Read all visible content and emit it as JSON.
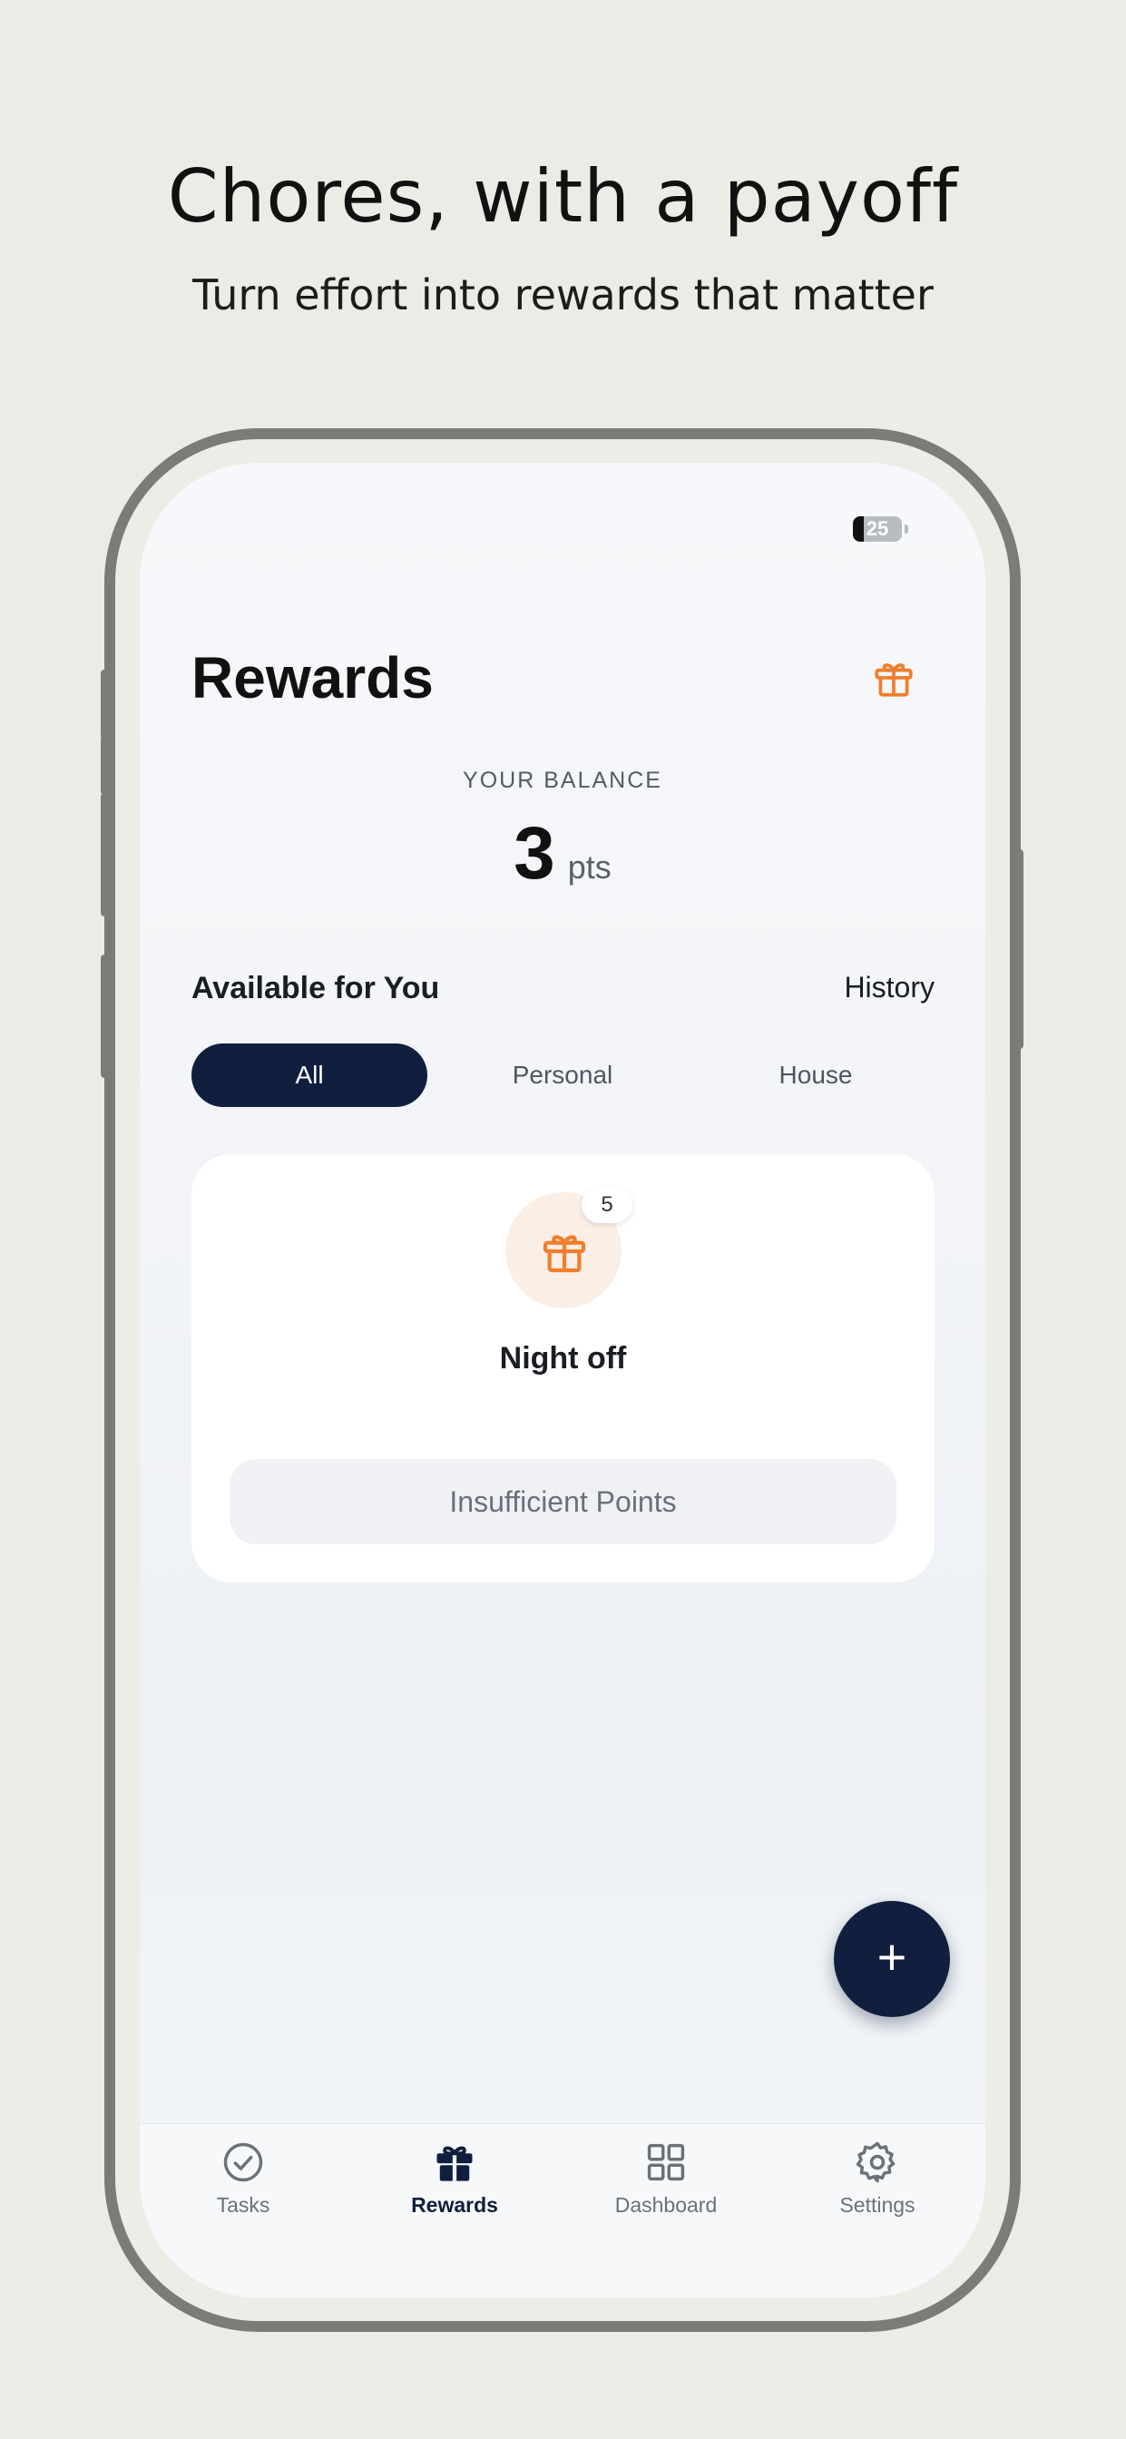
{
  "promo": {
    "headline": "Chores, with a payoff",
    "subheadline": "Turn effort into rewards that matter"
  },
  "status_bar": {
    "battery": "25"
  },
  "header": {
    "title": "Rewards",
    "gift_icon": "gift-icon"
  },
  "balance": {
    "label": "YOUR BALANCE",
    "value": "3",
    "unit": "pts"
  },
  "section": {
    "title": "Available for You",
    "history_link": "History"
  },
  "filters": {
    "tabs": [
      {
        "label": "All",
        "active": true
      },
      {
        "label": "Personal",
        "active": false
      },
      {
        "label": "House",
        "active": false
      }
    ]
  },
  "rewards": [
    {
      "name": "Night off",
      "cost": "5",
      "icon": "gift-icon",
      "action_label": "Insufficient Points"
    }
  ],
  "fab": {
    "label": "+"
  },
  "tab_bar": {
    "items": [
      {
        "label": "Tasks",
        "icon": "check-circle-icon",
        "active": false
      },
      {
        "label": "Rewards",
        "icon": "gift-icon",
        "active": true
      },
      {
        "label": "Dashboard",
        "icon": "grid-icon",
        "active": false
      },
      {
        "label": "Settings",
        "icon": "gear-icon",
        "active": false
      }
    ]
  },
  "colors": {
    "primary": "#0F1F3D",
    "accent": "#F07E2C",
    "background": "#EBECE6"
  }
}
